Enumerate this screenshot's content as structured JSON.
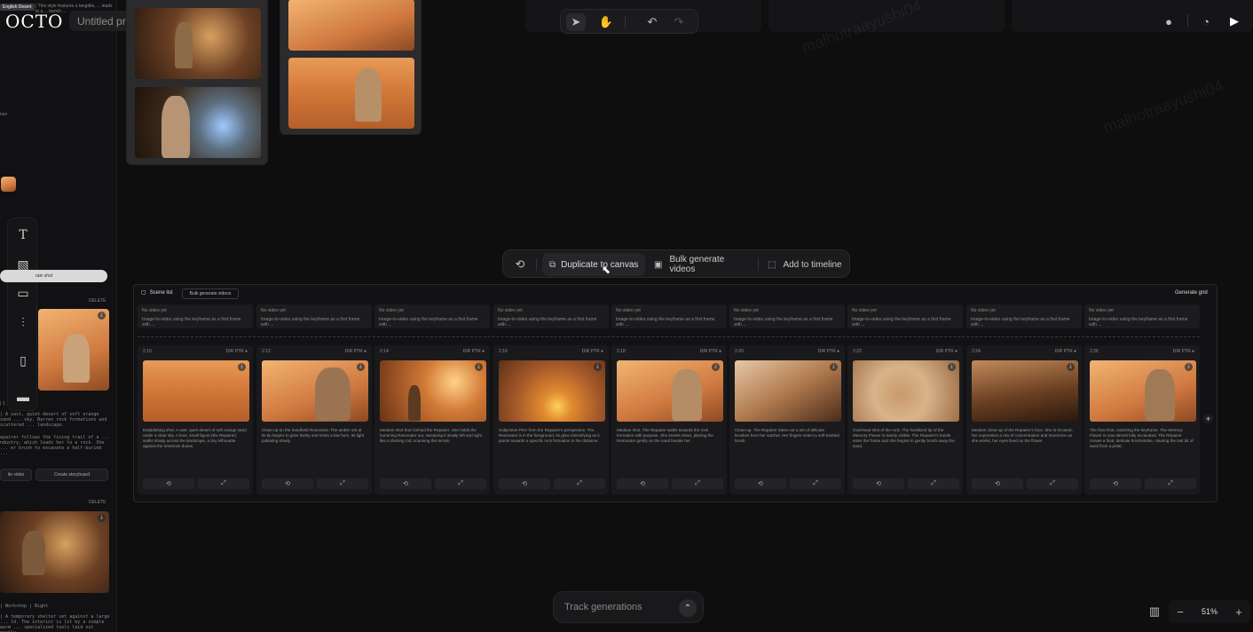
{
  "app": {
    "logo": "OCTO",
    "project_name": "Untitled proj...",
    "tag": "English Desert"
  },
  "left_panel": {
    "snippet_top": "| This style features a tangible, ... leads to a ... bench ...",
    "snippet_label": "nce",
    "caption1_tag": "| 1",
    "caption1": "| A vast, quiet desert of soft orange sand ... sky. Barren rock formations and scattered ... landscape.",
    "caption1b": "epairer follows the fining trail of a ... ndustry, which leads her to a rock. She ... er brush to excavate a half-buried ...",
    "delete1": "DELETE",
    "delete2": "DELETE",
    "btn_video": "ite video",
    "btn_storyboard": "Create storyboard",
    "pill_label": "rain shot",
    "caption2_tag": "| Workshop | Night",
    "caption2": "| A temporary shelter set against a large ... ld. The interior is lit by a simple warm ... specialized tools laid out neatly."
  },
  "floating_toolbar": {
    "duplicate": "Duplicate to canvas",
    "bulk": "Bulk generate videos",
    "timeline": "Add to timeline"
  },
  "scene_list": {
    "title": "Scene list",
    "bulk_button": "Bulk generate videos",
    "generate_grid": "Generate grid",
    "slot_title": "No video yet",
    "slot_sub": "Image-to-video using the keyframe as a first frame with ...",
    "cards": [
      {
        "time": "2:10",
        "meta": "DIR PTR ●",
        "desc": "Establishing shot. A vast, quiet desert of soft orange sand under a clear sky. A lone, small figure (the Repairer) walks slowly across the landscape, a tiny silhouette against the immense dunes."
      },
      {
        "time": "2:12",
        "meta": "DIR PTR ●",
        "desc": "Close-up on the handheld Resonator. The amber orb at its tip begins to glow faintly and emits a low hum. Its light pulsating slowly."
      },
      {
        "time": "2:14",
        "meta": "DIR PTR ●",
        "desc": "Medium shot from behind the Repairer. She holds the humming Resonator out, sweeping it slowly left and right like a divining rod, scanning the terrain."
      },
      {
        "time": "2:16",
        "meta": "DIR PTR ●",
        "desc": "Subjective POV from the Repairer's perspective. The Resonator is in the foreground, its glow intensifying as it points towards a specific rock formation in the distance."
      },
      {
        "time": "2:18",
        "meta": "DIR PTR ●",
        "desc": "Medium shot. The Repairer walks towards the rock formation with purpose. She kneels down, placing the Resonator gently on the sand beside her."
      },
      {
        "time": "2:20",
        "meta": "DIR PTR ●",
        "desc": "Close-up. The Repairer takes out a set of delicate brushes from her satchel. Her fingers select a soft-bristled brush."
      },
      {
        "time": "2:22",
        "meta": "DIR PTR ●",
        "desc": "Overhead shot of the rock. The fossilized tip of the Memory Flower is barely visible. The Repairer's hands enter the frame and she begins to gently brush away the sand."
      },
      {
        "time": "2:24",
        "meta": "DIR PTR ●",
        "desc": "Medium close-up of the Repairer's face. She is focused, her expression a mix of concentration and reverence as she works, her eyes fixed on the flower."
      },
      {
        "time": "2:26",
        "meta": "DIR PTR ●",
        "desc": "The final shot, matching the keyframe. The Memory Flower is now almost fully excavated. The Repairer moves a final, delicate brushstroke, clearing the last bit of sand from a petal."
      }
    ],
    "btn_left": "⟲",
    "btn_right": "⤢"
  },
  "bottom": {
    "track": "Track generations",
    "zoom": "51%",
    "minus": "−",
    "plus": "+"
  },
  "watermark": "malhotraayushi04"
}
